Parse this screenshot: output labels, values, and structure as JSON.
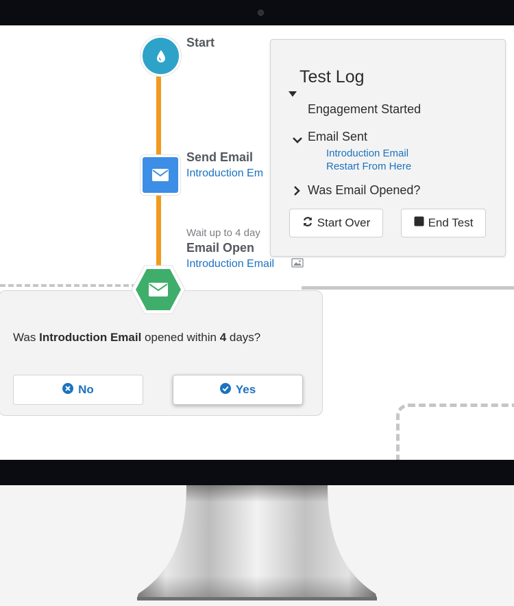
{
  "flow": {
    "start": {
      "label": "Start",
      "icon": "droplet-icon"
    },
    "send_email": {
      "label": "Send Email",
      "link": "Introduction Em",
      "icon": "envelope-icon"
    },
    "email_open": {
      "wait_note": "Wait up to 4 day",
      "label": "Email Open",
      "link": "Introduction Email",
      "icon": "envelope-icon"
    }
  },
  "test_log": {
    "title": "Test Log",
    "items": {
      "engagement_started": "Engagement Started",
      "email_sent": "Email Sent",
      "email_sent_links": [
        "Introduction Email",
        "Restart From Here"
      ],
      "was_email_opened": "Was Email Opened?"
    },
    "buttons": {
      "start_over": "Start Over",
      "end_test": "End Test"
    }
  },
  "decision": {
    "question_prefix": "Was ",
    "question_email": "Introduction Email",
    "question_mid": " opened within ",
    "question_days": "4",
    "question_suffix": " days?",
    "no_label": "No",
    "yes_label": "Yes"
  },
  "colors": {
    "connector": "#f29a1e",
    "start_node": "#2ea3c9",
    "email_node": "#3d8ee6",
    "decision_node": "#3fae6a",
    "link": "#1b72c0"
  }
}
